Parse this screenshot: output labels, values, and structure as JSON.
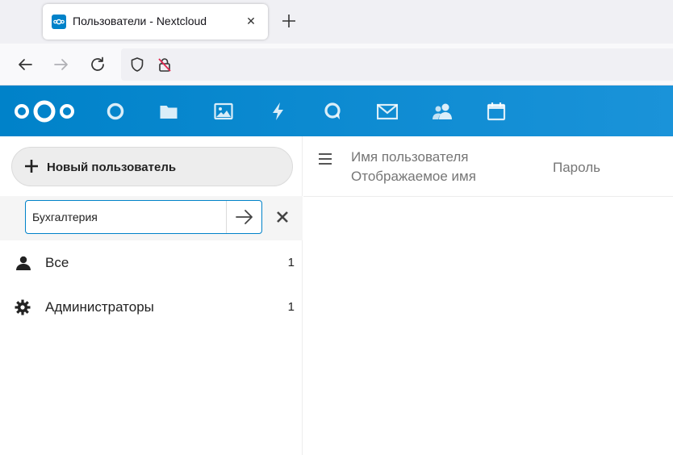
{
  "browser": {
    "tab_title": "Пользователи - Nextcloud",
    "tab_close": "✕"
  },
  "header": {
    "apps": [
      "dashboard-icon",
      "files-icon",
      "photos-icon",
      "activity-icon",
      "talk-icon",
      "mail-icon",
      "contacts-icon",
      "calendar-icon"
    ]
  },
  "sidebar": {
    "new_user_label": "Новый пользователь",
    "group_input_value": "Бухгалтерия",
    "groups": [
      {
        "label": "Все",
        "count": "1",
        "icon": "user-icon"
      },
      {
        "label": "Администраторы",
        "count": "1",
        "icon": "gear-icon"
      }
    ]
  },
  "list": {
    "col_username": "Имя пользователя",
    "col_displayname": "Отображаемое имя",
    "col_password": "Пароль"
  },
  "colors": {
    "accent": "#0082c9",
    "header_end": "#1a93d9"
  }
}
